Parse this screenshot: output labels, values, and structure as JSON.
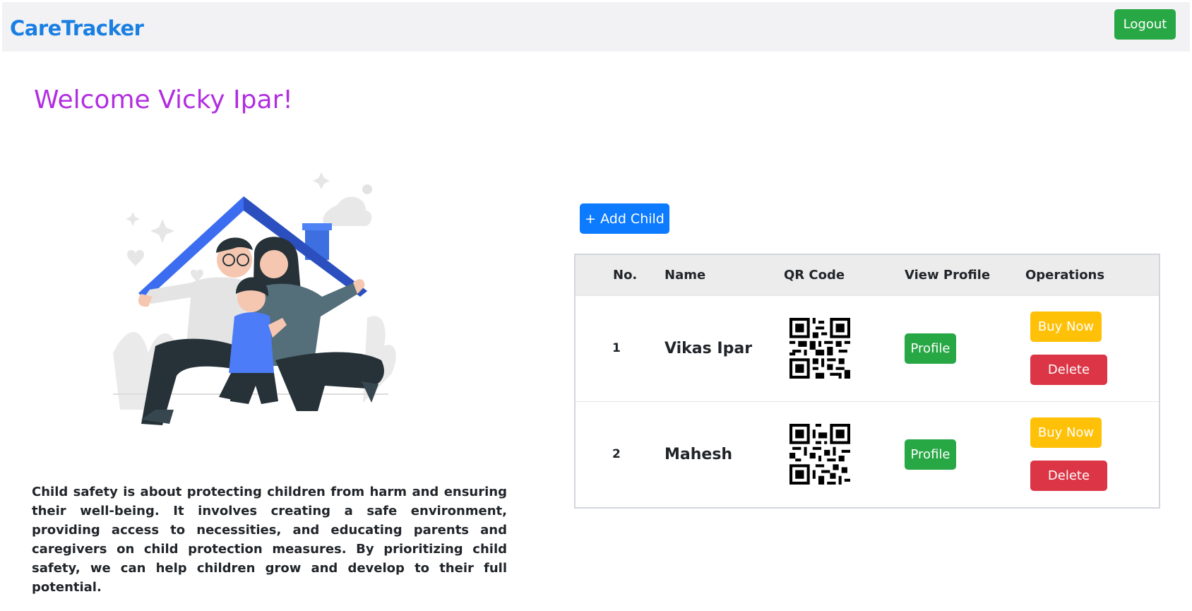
{
  "navbar": {
    "brand": "CareTracker",
    "logout_label": "Logout"
  },
  "welcome": "Welcome Vicky Ipar!",
  "description": "Child safety is about protecting children from harm and ensuring their well-being. It involves creating a safe environment, providing access to necessities, and educating parents and caregivers on child protection measures. By prioritizing child safety, we can help children grow and develop to their full potential.",
  "add_child_label": "+ Add Child",
  "table": {
    "headers": [
      "No.",
      "Name",
      "QR Code",
      "View Profile",
      "Operations"
    ],
    "rows": [
      {
        "no": "1",
        "name": "Vikas Ipar",
        "profile_label": "Profile",
        "buy_label": "Buy Now",
        "delete_label": "Delete"
      },
      {
        "no": "2",
        "name": "Mahesh",
        "profile_label": "Profile",
        "buy_label": "Buy Now",
        "delete_label": "Delete"
      }
    ]
  },
  "colors": {
    "brand": "#1a7fe3",
    "welcome": "#b12ee0",
    "success": "#28a745",
    "primary": "#0d7bff",
    "warning": "#ffc107",
    "danger": "#dc3545"
  },
  "icons": [
    "family-illustration",
    "qr-code-icon"
  ]
}
